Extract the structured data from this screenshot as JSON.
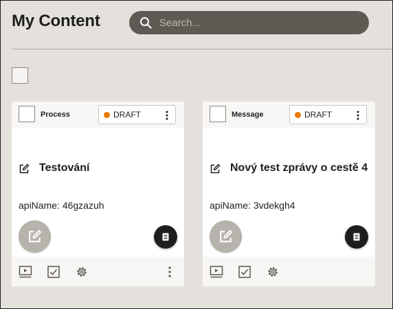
{
  "header": {
    "title": "My Content"
  },
  "search": {
    "placeholder": "Search..."
  },
  "cards": [
    {
      "type": "Process",
      "status": "DRAFT",
      "title": "Testování",
      "api_label": "apiName:",
      "api_value": "46gzazuh"
    },
    {
      "type": "Message",
      "status": "DRAFT",
      "title": "Nový test zprávy o cestě 4",
      "api_label": "apiName:",
      "api_value": "3vdekgh4"
    }
  ],
  "colors": {
    "background": "#e4e1dc",
    "search_bg": "#5e5953",
    "status_draft": "#e87a00",
    "fab_edit": "#b6b2ac",
    "fab_doc": "#1e1e1e"
  },
  "icons": {
    "search": "search-icon",
    "edit": "edit-icon",
    "document": "document-icon",
    "preview": "preview-icon",
    "validate": "checkbox-check-icon",
    "settings": "gear-icon",
    "more": "kebab-icon"
  }
}
